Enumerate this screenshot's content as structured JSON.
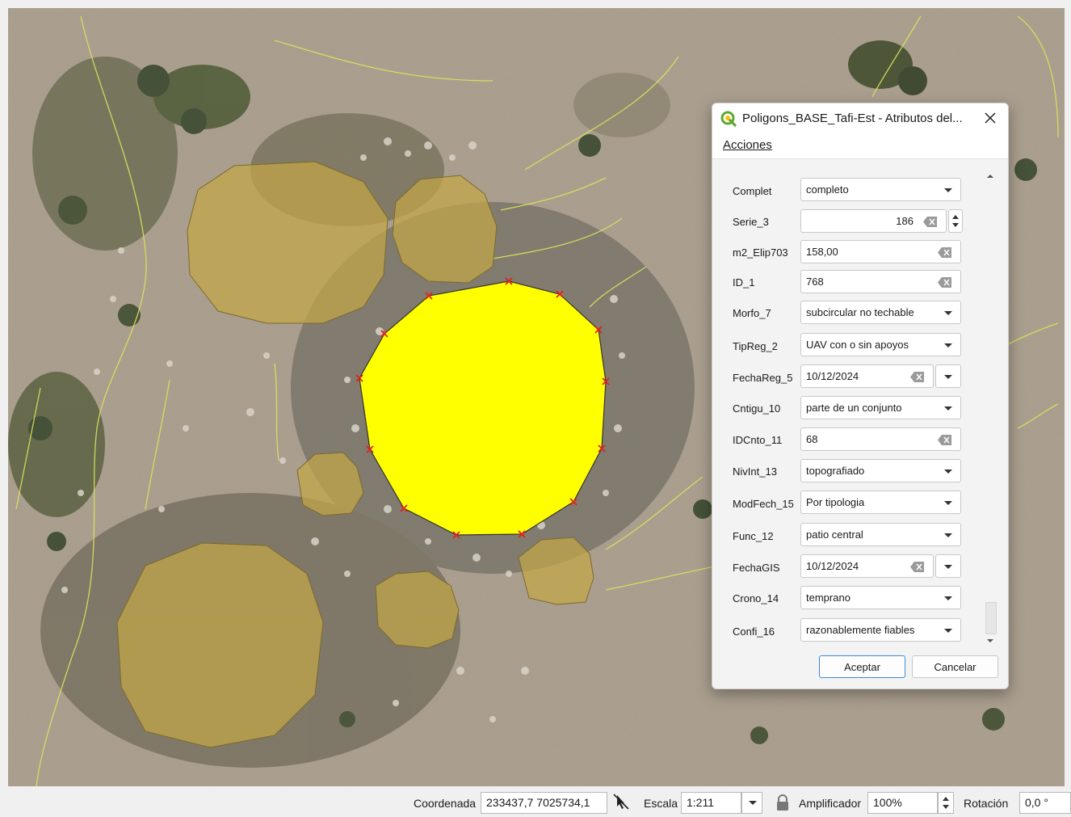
{
  "dialog": {
    "title": "Poligons_BASE_Tafi-Est - Atributos del...",
    "menu": [
      "Acciones"
    ],
    "fields": [
      {
        "label": "Complet",
        "value": "completo",
        "kind": "combo"
      },
      {
        "label": "Serie_3",
        "value": "186",
        "kind": "spin"
      },
      {
        "label": "m2_Elip703",
        "value": "158,00",
        "kind": "text"
      },
      {
        "label": "ID_1",
        "value": "768",
        "kind": "text"
      },
      {
        "label": "Morfo_7",
        "value": "subcircular no techable",
        "kind": "combo"
      },
      {
        "label": "TipReg_2",
        "value": "UAV con o sin apoyos",
        "kind": "combo"
      },
      {
        "label": "FechaReg_5",
        "value": "10/12/2024",
        "kind": "date"
      },
      {
        "label": "Cntigu_10",
        "value": "parte de un conjunto",
        "kind": "combo"
      },
      {
        "label": "IDCnto_11",
        "value": "68",
        "kind": "text"
      },
      {
        "label": "NivInt_13",
        "value": "topografiado",
        "kind": "combo"
      },
      {
        "label": "ModFech_15",
        "value": "Por tipologia",
        "kind": "combo"
      },
      {
        "label": "Func_12",
        "value": "patio central",
        "kind": "combo"
      },
      {
        "label": "FechaGIS",
        "value": "10/12/2024",
        "kind": "date"
      },
      {
        "label": "Crono_14",
        "value": "temprano",
        "kind": "combo"
      },
      {
        "label": "Confi_16",
        "value": "razonablemente fiables",
        "kind": "combo"
      }
    ],
    "ok_label": "Aceptar",
    "cancel_label": "Cancelar"
  },
  "statusbar": {
    "coord_label": "Coordenada",
    "coord_value": "233437,7 7025734,1",
    "scale_label": "Escala",
    "scale_value": "1:211",
    "magnifier_label": "Amplificador",
    "magnifier_value": "100%",
    "rotation_label": "Rotación",
    "rotation_value": "0,0 °"
  },
  "colors": {
    "selected_polygon": "#ffff00",
    "other_polygons": "#c4a646",
    "vertex_marker": "#e02020",
    "qgis_green": "#5fa82e",
    "primary_button_border": "#3b8ad9"
  },
  "icons": [
    "qgis-logo-icon",
    "close-icon",
    "chevron-down-icon",
    "clear-icon",
    "spin-up-icon",
    "spin-down-icon",
    "scroll-up-icon",
    "scroll-down-icon",
    "mouse-render-icon",
    "lock-icon"
  ]
}
